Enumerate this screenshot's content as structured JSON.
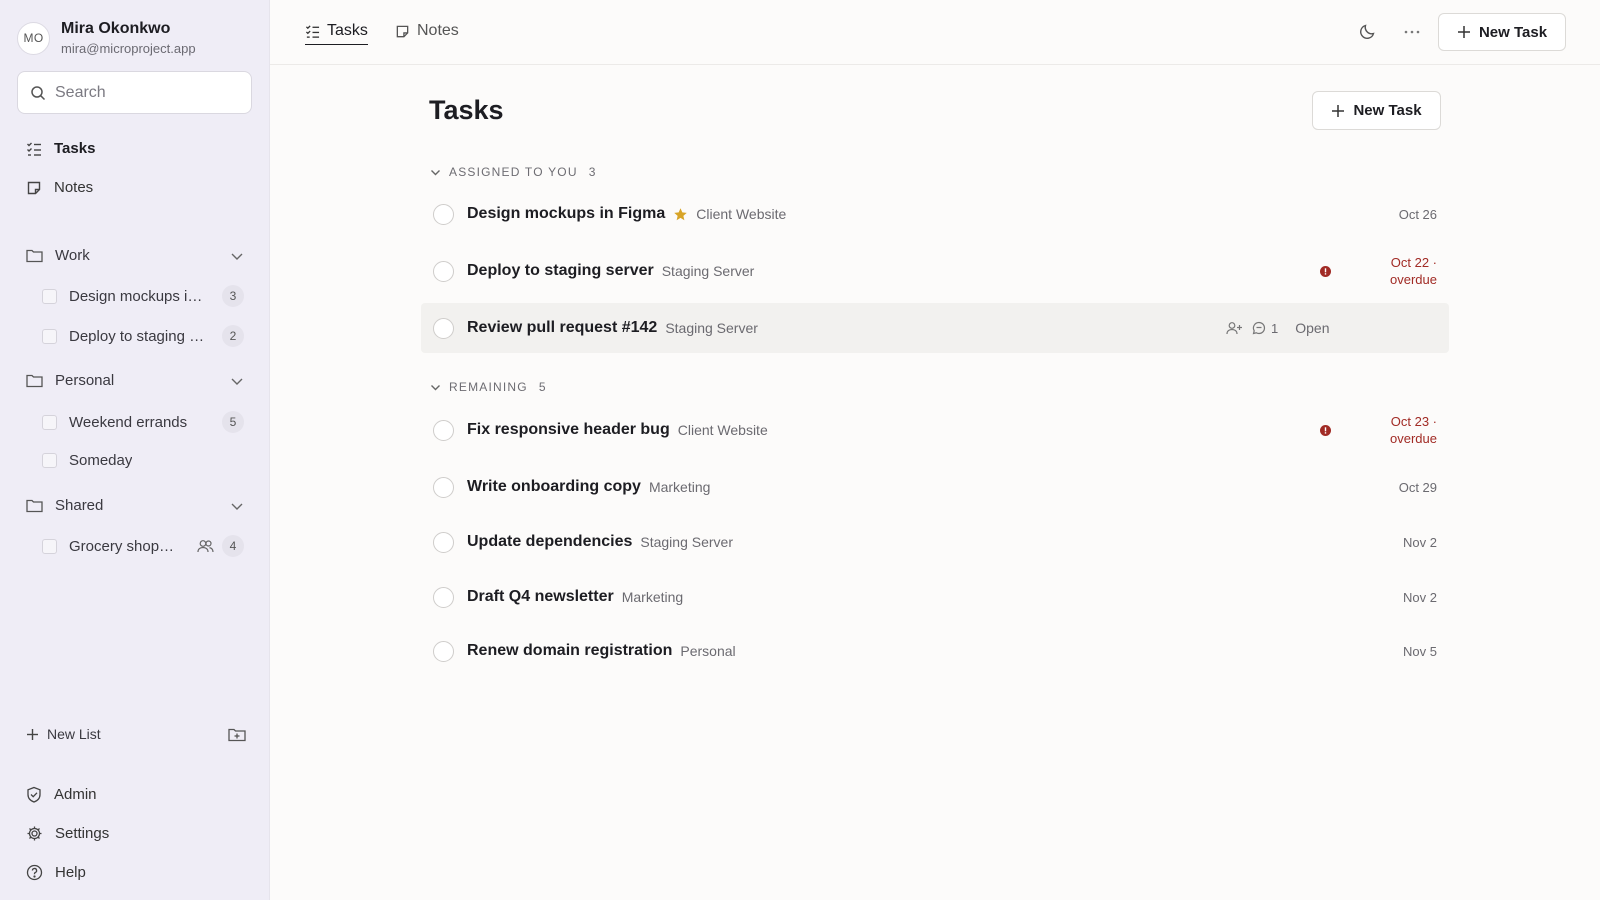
{
  "user": {
    "initials": "MO",
    "name": "Mira Okonkwo",
    "email": "mira@microproject.app"
  },
  "search": {
    "placeholder": "Search"
  },
  "nav": [
    {
      "label": "Tasks",
      "icon": "checklist-icon",
      "active": true
    },
    {
      "label": "Notes",
      "icon": "note-icon",
      "active": false
    }
  ],
  "folders": [
    {
      "label": "Work",
      "items": [
        {
          "label": "Design mockups in Figma",
          "count": "3"
        },
        {
          "label": "Deploy to staging server",
          "count": "2"
        }
      ]
    },
    {
      "label": "Personal",
      "items": [
        {
          "label": "Weekend errands",
          "count": "5"
        },
        {
          "label": "Someday",
          "count": ""
        }
      ]
    },
    {
      "label": "Shared",
      "items": [
        {
          "label": "Grocery shopping",
          "count": "4",
          "shared": true
        }
      ]
    }
  ],
  "sidebar_footer": {
    "new_list": "New List",
    "admin": "Admin",
    "settings": "Settings",
    "help": "Help"
  },
  "topbar": {
    "tabs": [
      {
        "label": "Tasks",
        "active": true
      },
      {
        "label": "Notes",
        "active": false
      }
    ],
    "new_task": "New Task"
  },
  "main": {
    "title": "Tasks",
    "new_task": "New Task",
    "sections": [
      {
        "label": "ASSIGNED TO YOU",
        "count": "3",
        "tasks": [
          {
            "title": "Design mockups in Figma",
            "starred": true,
            "project": "Client Website",
            "due": "Oct 26"
          },
          {
            "title": "Deploy to staging server",
            "project": "Staging Server",
            "due": "Oct 22 ·",
            "due2": "overdue",
            "overdue": true
          },
          {
            "title": "Review pull request #142",
            "project": "Staging Server",
            "comments": "1",
            "status": "Open",
            "hovered": true
          }
        ]
      },
      {
        "label": "REMAINING",
        "count": "5",
        "tasks": [
          {
            "title": "Fix responsive header bug",
            "project": "Client Website",
            "due": "Oct 23 ·",
            "due2": "overdue",
            "overdue": true
          },
          {
            "title": "Write onboarding copy",
            "project": "Marketing",
            "due": "Oct 29"
          },
          {
            "title": "Update dependencies",
            "project": "Staging Server",
            "due": "Nov 2"
          },
          {
            "title": "Draft Q4 newsletter",
            "project": "Marketing",
            "due": "Nov 2"
          },
          {
            "title": "Renew domain registration",
            "project": "Personal",
            "due": "Nov 5"
          }
        ]
      }
    ]
  },
  "colors": {
    "sidebar_bg": "#efedf6",
    "overdue": "#a12b25",
    "star": "#d8a427",
    "main_bg": "#fcfbfa"
  }
}
